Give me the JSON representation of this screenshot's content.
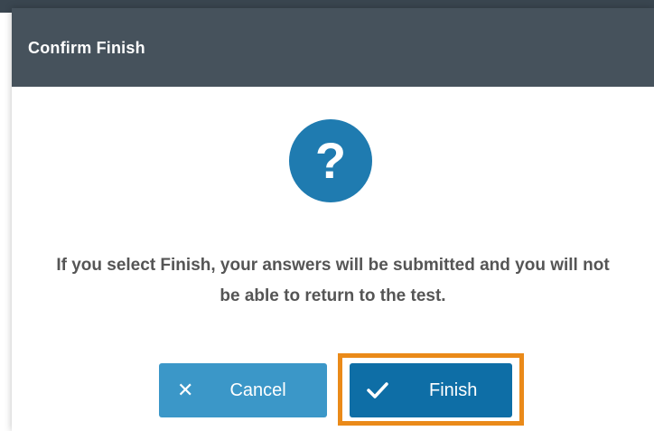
{
  "dialog": {
    "title": "Confirm Finish",
    "icon": "question-icon",
    "icon_glyph": "?",
    "message": "If you select Finish, your answers will be submitted and you will not be able to return to the test.",
    "buttons": {
      "cancel_label": "Cancel",
      "cancel_icon": "close-icon",
      "finish_label": "Finish",
      "finish_icon": "checkmark-icon"
    }
  },
  "colors": {
    "titlebar": "#46525c",
    "primary": "#0e6ea6",
    "icon_circle": "#1f7bb0",
    "highlight": "#ea8a19"
  }
}
